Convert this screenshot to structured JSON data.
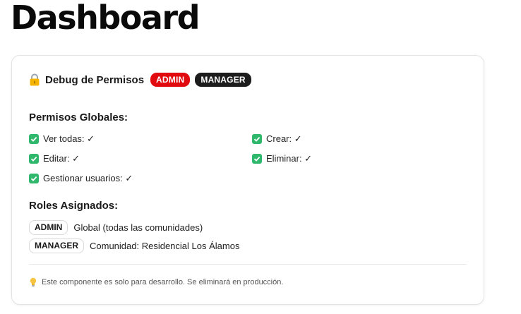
{
  "page": {
    "title": "Dashboard"
  },
  "debug_card": {
    "title": "Debug de Permisos",
    "icon": "lock-icon",
    "badges": [
      "ADMIN",
      "MANAGER"
    ],
    "badge_colors": {
      "admin": "#e00a0f",
      "manager": "#1c1c1c"
    },
    "global_permissions": {
      "title": "Permisos Globales:",
      "items": [
        {
          "label": "Ver todas: ✓",
          "icon": "check-icon"
        },
        {
          "label": "Crear: ✓",
          "icon": "check-icon"
        },
        {
          "label": "Editar: ✓",
          "icon": "check-icon"
        },
        {
          "label": "Eliminar: ✓",
          "icon": "check-icon"
        },
        {
          "label": "Gestionar usuarios: ✓",
          "icon": "check-icon"
        }
      ]
    },
    "roles": {
      "title": "Roles Asignados:",
      "items": [
        {
          "role": "ADMIN",
          "scope": "Global (todas las comunidades)"
        },
        {
          "role": "MANAGER",
          "scope": "Comunidad: Residencial Los Álamos"
        }
      ]
    },
    "footer_note": "Este componente es solo para desarrollo. Se eliminará en producción.",
    "footer_icon": "lightbulb-icon",
    "check_color": "#2fb86b"
  }
}
